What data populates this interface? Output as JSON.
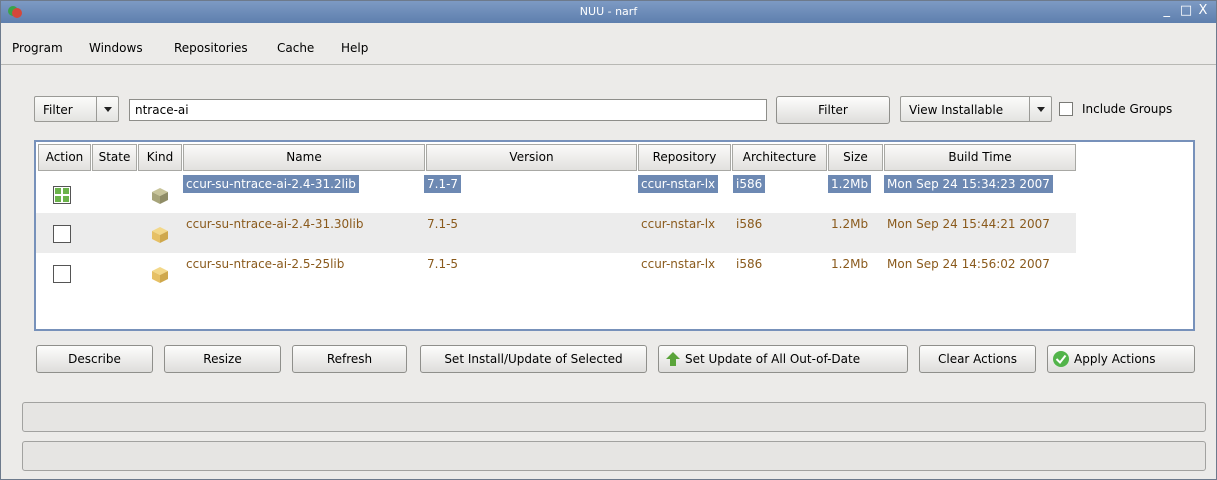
{
  "window": {
    "title": "NUU - narf",
    "minimize": "_",
    "maximize": "□",
    "close": "X"
  },
  "menu": [
    "Program",
    "Windows",
    "Repositories",
    "Cache",
    "Help"
  ],
  "filterbar": {
    "filter_field": "Filter",
    "search_value": "ntrace-ai",
    "filter_button": "Filter",
    "view_mode": "View Installable",
    "include_groups": "Include Groups"
  },
  "table": {
    "columns": [
      "Action",
      "State",
      "Kind",
      "Name",
      "Version",
      "Repository",
      "Architecture",
      "Size",
      "Build Time"
    ],
    "rows": [
      {
        "name": "ccur-su-ntrace-ai-2.4-31.2lib",
        "version": "7.1-7",
        "repository": "ccur-nstar-lx",
        "arch": "i586",
        "size": "1.2Mb",
        "build_time": "Mon Sep 24 15:34:23 2007",
        "action": "install",
        "selected": true
      },
      {
        "name": "ccur-su-ntrace-ai-2.4-31.30lib",
        "version": "7.1-5",
        "repository": "ccur-nstar-lx",
        "arch": "i586",
        "size": "1.2Mb",
        "build_time": "Mon Sep 24 15:44:21 2007",
        "action": "none",
        "selected": false
      },
      {
        "name": "ccur-su-ntrace-ai-2.5-25lib",
        "version": "7.1-5",
        "repository": "ccur-nstar-lx",
        "arch": "i586",
        "size": "1.2Mb",
        "build_time": "Mon Sep 24 14:56:02 2007",
        "action": "none",
        "selected": false
      }
    ]
  },
  "buttons": {
    "describe": "Describe",
    "resize": "Resize",
    "refresh": "Refresh",
    "set_install": "Set Install/Update of Selected",
    "set_update_all": "Set Update of All Out-of-Date",
    "clear_actions": "Clear Actions",
    "apply_actions": "Apply Actions"
  },
  "colors": {
    "selection": "#6d89b3",
    "package_text": "#8a5a1c",
    "table_border": "#7791ba"
  }
}
